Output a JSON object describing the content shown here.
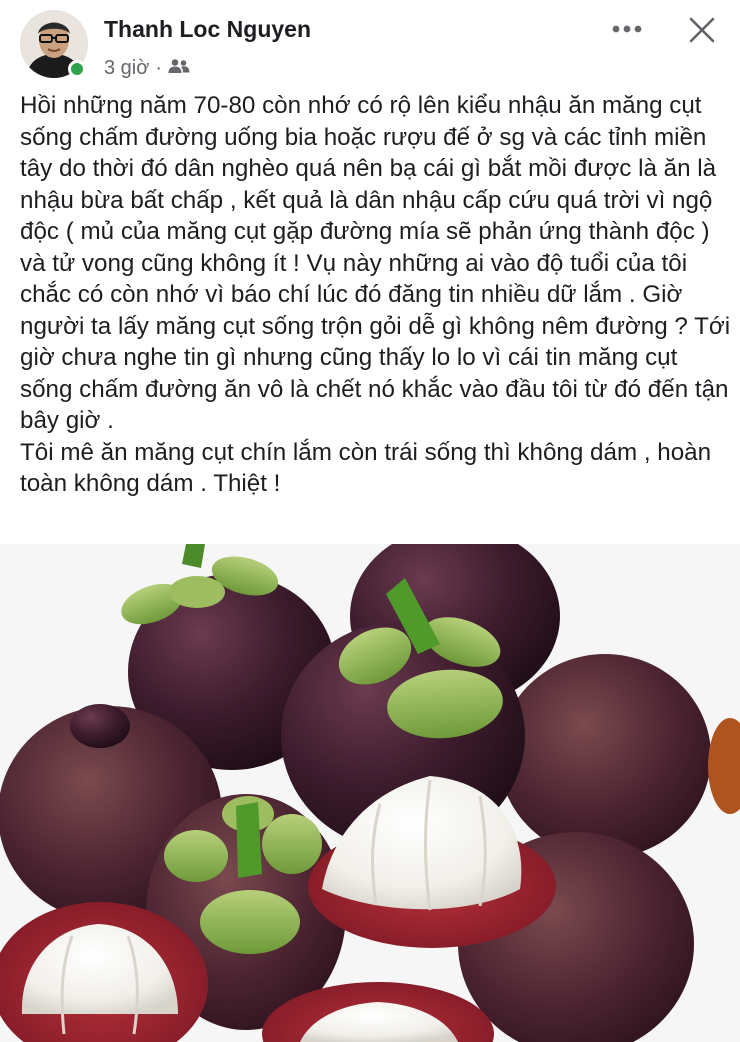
{
  "post": {
    "author": "Thanh Loc Nguyen",
    "time": "3 giờ",
    "separator": "·",
    "audience_icon": "friends-icon",
    "more_icon": "more-icon",
    "close_icon": "close-icon",
    "text": "Hồi những năm 70-80 còn nhớ có rộ lên kiểu nhậu ăn măng cụt sống chấm đường uống bia hoặc rượu đế ở sg và các tỉnh miền tây do thời đó dân nghèo quá nên bạ cái gì bắt mồi được là ăn là nhậu bừa bất chấp , kết quả là dân nhậu cấp cứu quá trời vì ngộ độc ( mủ của măng cụt gặp đường mía sẽ phản ứng thành độc ) và tử vong cũng không ít ! Vụ này những ai vào độ tuổi của tôi chắc có còn nhớ vì báo chí lúc đó đăng tin nhiều dữ lắm . Giờ người ta lấy măng cụt sống trộn gỏi dễ gì không nêm đường ? Tới giờ chưa nghe tin gì nhưng cũng thấy lo lo vì cái tin măng cụt sống chấm đường ăn vô là chết nó khắc vào đầu tôi từ đó đến tận bây giờ .\nTôi mê ăn măng cụt chín lắm còn trái sống thì không dám , hoàn toàn không dám . Thiệt !"
  },
  "colors": {
    "text": "#1c1e21",
    "meta": "#65676b",
    "online": "#31a24c"
  }
}
